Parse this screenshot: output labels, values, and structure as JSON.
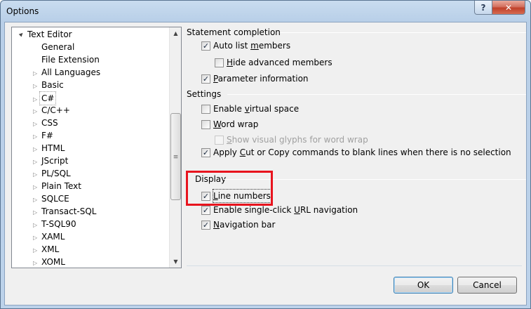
{
  "window": {
    "title": "Options",
    "help_label": "?",
    "close_label": "✕"
  },
  "tree": {
    "root": "Text Editor",
    "items": [
      {
        "label": "General",
        "expandable": false
      },
      {
        "label": "File Extension",
        "expandable": false
      },
      {
        "label": "All Languages",
        "expandable": true
      },
      {
        "label": "Basic",
        "expandable": true
      },
      {
        "label": "C#",
        "expandable": true,
        "selected": true
      },
      {
        "label": "C/C++",
        "expandable": true
      },
      {
        "label": "CSS",
        "expandable": true
      },
      {
        "label": "F#",
        "expandable": true
      },
      {
        "label": "HTML",
        "expandable": true
      },
      {
        "label": "JScript",
        "expandable": true
      },
      {
        "label": "PL/SQL",
        "expandable": true
      },
      {
        "label": "Plain Text",
        "expandable": true
      },
      {
        "label": "SQLCE",
        "expandable": true
      },
      {
        "label": "Transact-SQL",
        "expandable": true
      },
      {
        "label": "T-SQL90",
        "expandable": true
      },
      {
        "label": "XAML",
        "expandable": true
      },
      {
        "label": "XML",
        "expandable": true
      },
      {
        "label": "XOML",
        "expandable": true
      }
    ]
  },
  "statement_completion": {
    "header": "Statement completion",
    "auto_list_members": {
      "pre": "Auto list ",
      "u": "m",
      "post": "embers",
      "checked": true
    },
    "hide_advanced_members": {
      "pre": "",
      "u": "H",
      "post": "ide advanced members",
      "checked": false
    },
    "parameter_information": {
      "pre": "",
      "u": "P",
      "post": "arameter information",
      "checked": true
    }
  },
  "settings": {
    "header": "Settings",
    "enable_virtual_space": {
      "pre": "Enable ",
      "u": "v",
      "post": "irtual space",
      "checked": false
    },
    "word_wrap": {
      "pre": "",
      "u": "W",
      "post": "ord wrap",
      "checked": false
    },
    "show_visual_glyphs": {
      "pre": "",
      "u": "S",
      "post": "how visual glyphs for word wrap",
      "checked": false,
      "disabled": true
    },
    "apply_cut_copy": {
      "pre": "Apply ",
      "u": "C",
      "post": "ut or Copy commands to blank lines when there is no selection",
      "checked": true
    }
  },
  "display": {
    "header": "Display",
    "line_numbers": {
      "pre": "",
      "u": "L",
      "post": "ine numbers",
      "checked": true
    },
    "single_click_url": {
      "pre": "Enable single-click ",
      "u": "U",
      "post": "RL navigation",
      "checked": true
    },
    "navigation_bar": {
      "pre": "",
      "u": "N",
      "post": "avigation bar",
      "checked": true
    }
  },
  "buttons": {
    "ok": "OK",
    "cancel": "Cancel"
  },
  "icons": {
    "expanded_arrow": "▲",
    "collapsed_arrow": "▷",
    "scroll_up": "▲",
    "scroll_down": "▼",
    "thumb_grip": "≡",
    "check": "✓"
  },
  "colors": {
    "highlight_box": "#e8141e"
  }
}
